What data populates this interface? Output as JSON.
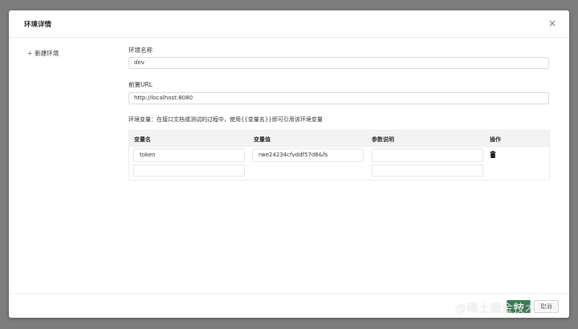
{
  "dialog": {
    "title": "环境详情",
    "close_icon": "×"
  },
  "sidebar": {
    "new_env_plus": "+",
    "new_env_label": "新建环境"
  },
  "form": {
    "env_name_label": "环境名称",
    "env_name_value": "dev",
    "url_label": "前置URL",
    "url_value": "http://localhost:8080",
    "variables_hint": "环境变量：在接口文档或测试的过程中，使用{{变量名}}即可引用该环境变量"
  },
  "variables_table": {
    "columns": [
      "变量名",
      "变量值",
      "参数说明",
      "操作"
    ],
    "rows": [
      {
        "name": "token",
        "value": "rwe24234cfvddf57d6&fs",
        "description": ""
      }
    ],
    "delete_icon": "trash-icon"
  },
  "footer": {
    "save_label": "保存",
    "cancel_label": "取消"
  },
  "watermark": "@稀土掘金技术社区",
  "colors": {
    "primary": "#3d7a52",
    "backdrop": "#7d7d7d",
    "table_header_bg": "#f3f3f3"
  }
}
